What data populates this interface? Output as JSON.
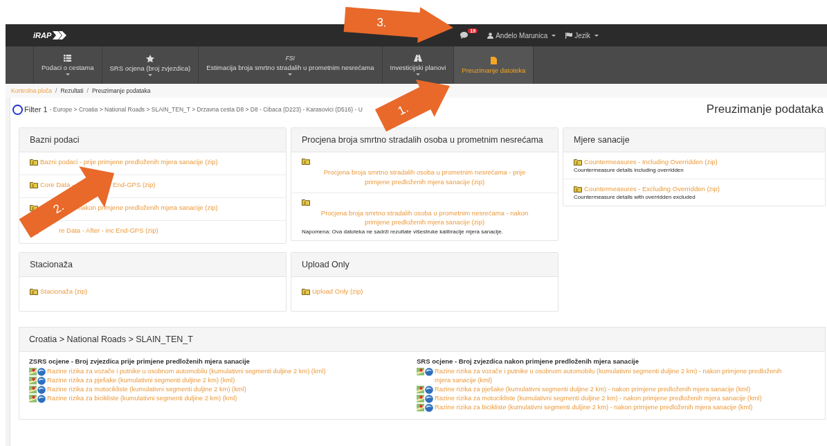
{
  "topbar": {
    "logo": "iRAP",
    "messages_badge": "19",
    "user": "Andelo Marunica",
    "language": "Jezik"
  },
  "nav": [
    {
      "kind": "list",
      "label": "Podaci o cestama",
      "dropdown": true,
      "selected": false
    },
    {
      "kind": "star",
      "label": "SRS ocjena (broj zvjezdica)",
      "dropdown": true,
      "selected": false
    },
    {
      "kind": "text",
      "icon_text": "FSI",
      "label": "Estimacija broja smrtno stradalih u prometnim nesrećama",
      "dropdown": true,
      "selected": false
    },
    {
      "kind": "road",
      "label": "Investicijski planovi",
      "dropdown": true,
      "selected": false
    },
    {
      "kind": "file",
      "label": "Preuzimanje datoteka",
      "dropdown": false,
      "selected": true
    }
  ],
  "breadcrumb": {
    "separator": "/",
    "items": [
      "Kontrolna ploča",
      "Rezultati",
      "Preuzimanje podataka"
    ]
  },
  "filter": {
    "label": "Filter 1",
    "path": "- Europe > Croatia > National Roads > SLAIN_TEN_T > Drzavna cesta D8 > D8 - Cibaca (D223) - Karasovici (D516) - U"
  },
  "page_title": "Preuzimanje podataka",
  "panels": [
    {
      "title": "Bazni podaci",
      "kind": "inline",
      "items": [
        {
          "parts": [
            "Bazni podaci - prije primjene predloženih mjera sanacije (zip)"
          ]
        },
        {
          "parts": [
            "Core Data -",
            "End-GPS (zip)"
          ]
        },
        {
          "hidden_start": true,
          "parts": [
            "nakon primjene predloženih mjera sanacije (zip)"
          ]
        },
        {
          "hidden_start": true,
          "parts": [
            "re Data - After - inc End-GPS (zip)"
          ]
        }
      ]
    },
    {
      "title": "Procjena broja smrtno stradalih osoba u prometnim nesrećama",
      "kind": "centered",
      "items": [
        {
          "parts": [
            "Procjena broja smrtno stradalih osoba u prometnim nesrećama - prije primjene predloženih mjera sanacije (zip)"
          ]
        },
        {
          "parts": [
            "Procjena broja smrtno stradalih osoba u prometnim nesrećama - nakon primjene predloženih mjera sanacije (zip)"
          ],
          "note": "Napomena: Ova datoteka ne sadrži rezultate višestruke kalibracije mjera sanacije."
        }
      ]
    },
    {
      "title": "Mjere sanacije",
      "kind": "inline",
      "items": [
        {
          "parts": [
            "Countermeasures - Including Overridden (zip)"
          ],
          "note": "Countermeasure details including overridden"
        },
        {
          "parts": [
            "Countermeasures - Excluding Overridden (zip)"
          ],
          "note": "Countermeasure details with overridden excluded"
        }
      ]
    },
    {
      "title": "Stacionaža",
      "kind": "inline",
      "items": [
        {
          "parts": [
            "Stacionaža (zip)"
          ]
        }
      ]
    },
    {
      "title": "Upload Only",
      "kind": "inline",
      "items": [
        {
          "parts": [
            "Upload Only (zip)"
          ]
        }
      ]
    }
  ],
  "results": {
    "title": "Croatia > National Roads > SLAIN_TEN_T",
    "columns": [
      {
        "heading": "ZSRS ocjene - Broj zvjezdica prije primjene predloženih mjera sanacije",
        "links": [
          "Razine rizika za vozače i putnike u osobnom automobilu (kumulativni segmenti duljine 2 km) (kml)",
          "Razine rizika za pješake (kumulativni segmenti duljine 2 km) (kml)",
          "Razine rizika za motocikliste (kumulativni segmenti duljine 2 km) (kml)",
          "Razine rizika za bicikliste (kumulativni segmenti duljine 2 km) (kml)"
        ]
      },
      {
        "heading": "SRS ocjene - Broj zvjezdica nakon primjene predloženih mjera sanacije",
        "links": [
          "Razine rizika za vozače i putnike u osobnom automobilu (kumulativni segmenti duljine 2 km) - nakon primjene predloženih mjera sanacije (kml)",
          "Razine rizika za pješake (kumulativni segmenti duljine 2 km) - nakon primjene predloženih mjera sanacije (kml)",
          "Razine rizika za motocikliste (kumulativni segmenti duljine 2 km) - nakon primjene predloženih mjera sanacije (kml)",
          "Razine rizika za bicikliste (kumulativni segmenti duljine 2 km) - nakon primjene predloženih mjera sanacije (kml)"
        ]
      }
    ]
  },
  "annotations": [
    {
      "label": "1."
    },
    {
      "label": "2."
    },
    {
      "label": "3."
    }
  ]
}
